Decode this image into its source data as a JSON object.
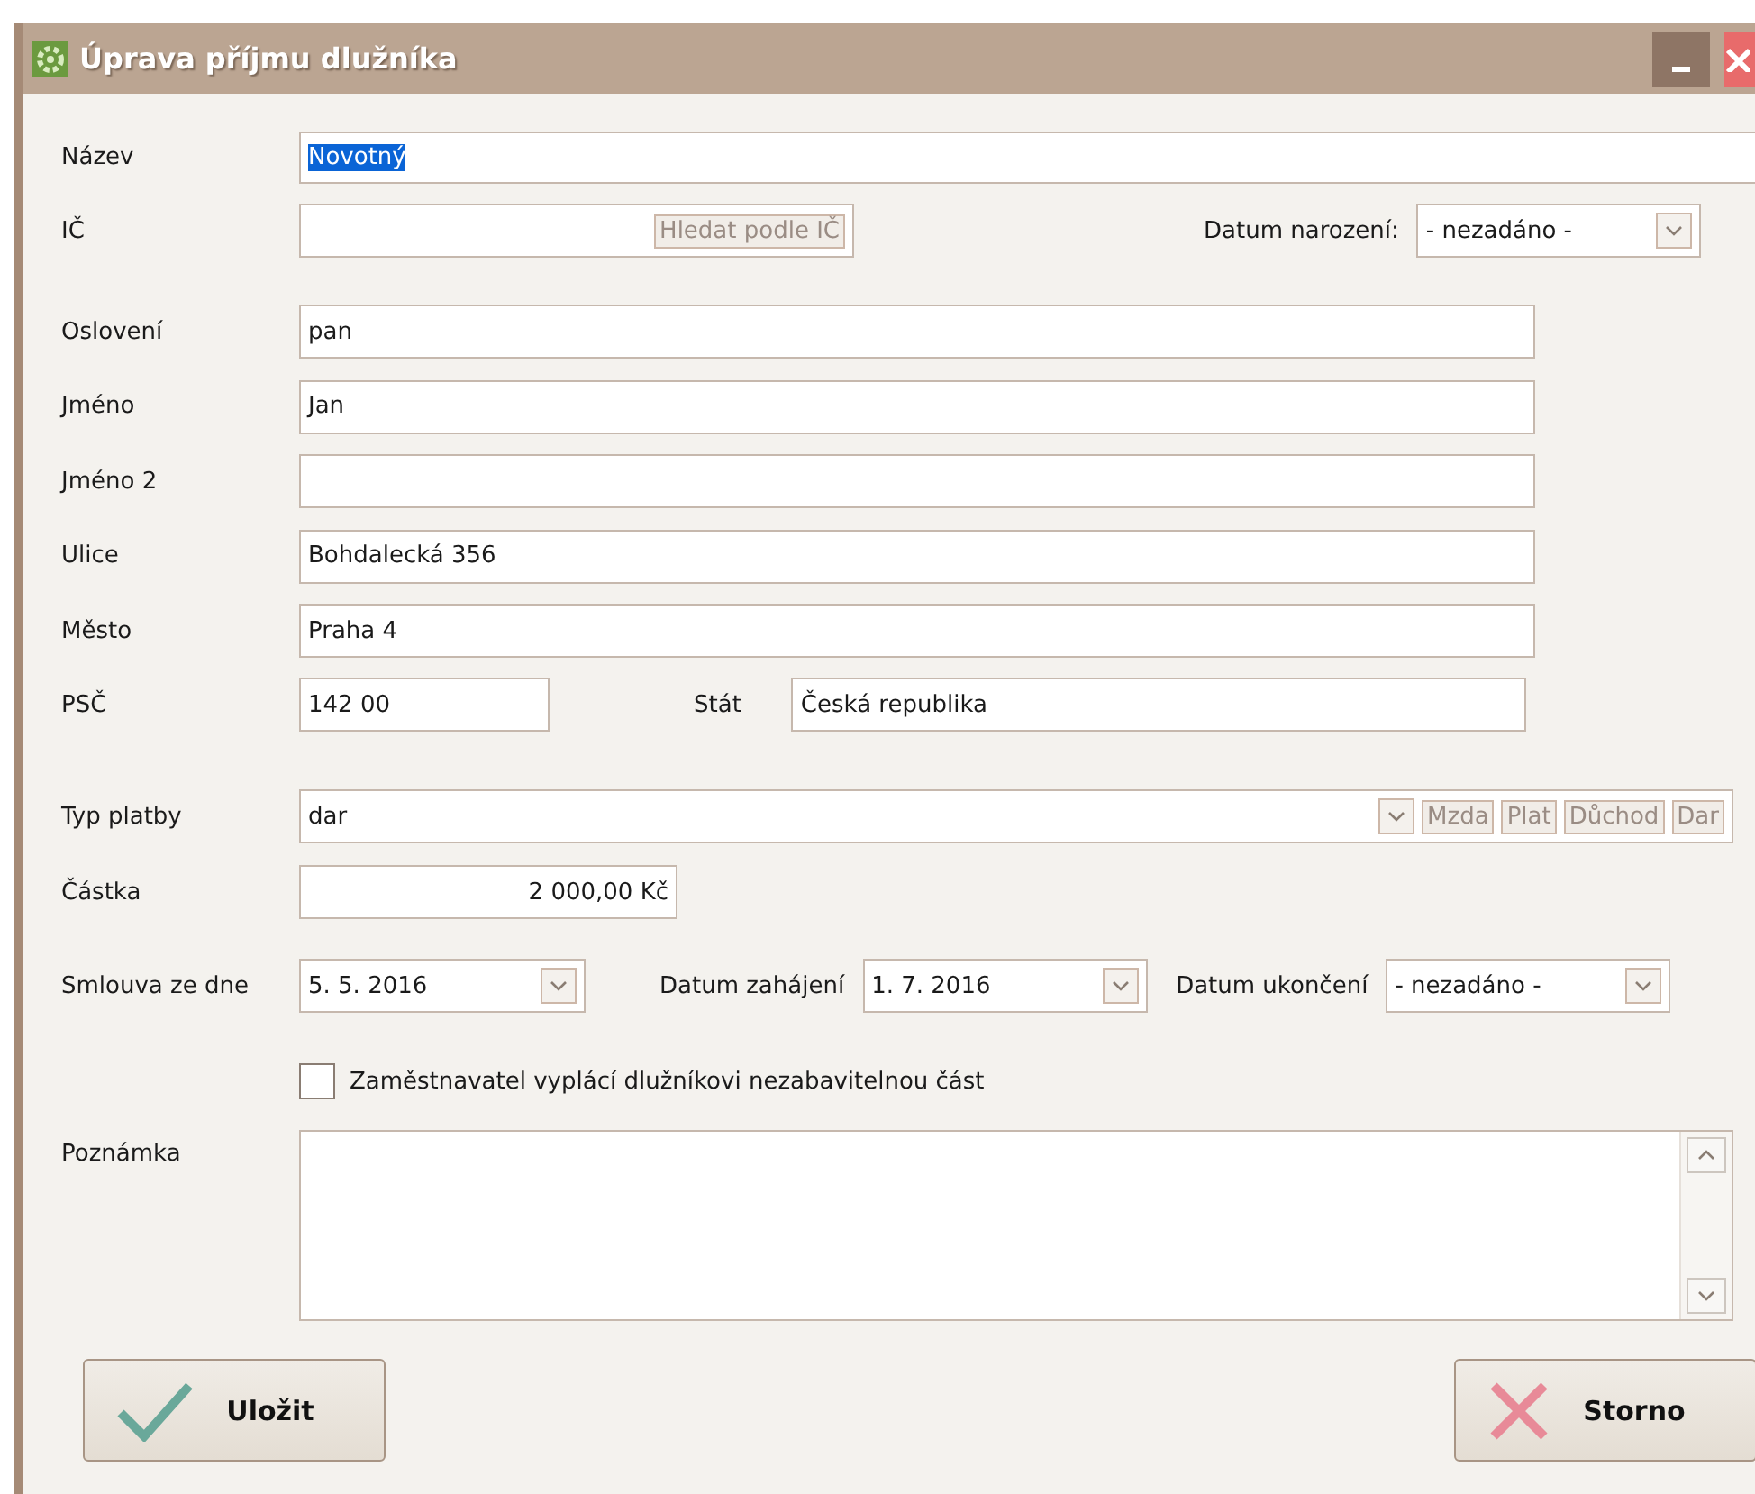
{
  "window": {
    "title": "Úprava příjmu dlužníka"
  },
  "name": {
    "label": "Název",
    "value": "Novotný",
    "selected": true
  },
  "ic": {
    "label": "IČ",
    "button": "Hledat podle IČ"
  },
  "birth_date": {
    "label": "Datum narození:",
    "value": "- nezadáno -"
  },
  "address": [
    {
      "label": "Oslovení",
      "value": "pan"
    },
    {
      "label": "Jméno",
      "value": "Jan"
    },
    {
      "label": "Jméno 2"
    },
    {
      "label": "Ulice",
      "value": "Bohdalecká 356"
    },
    {
      "label": "Město",
      "value": "Praha 4"
    }
  ],
  "postal": {
    "label": "PSČ",
    "value": "142 00"
  },
  "country": {
    "label": "Stát",
    "value": "Česká republika"
  },
  "payment_type": {
    "label": "Typ platby",
    "value": "dar",
    "quick_buttons": [
      "Mzda",
      "Plat",
      "Důchod",
      "Dar"
    ]
  },
  "amount": {
    "label": "Částka",
    "value": "2 000,00 Kč"
  },
  "dates": [
    {
      "label": "Smlouva ze dne",
      "value": "5. 5. 2016"
    },
    {
      "label": "Datum zahájení",
      "value": "1. 7. 2016"
    },
    {
      "label": "Datum ukončení",
      "value": "- nezadáno -"
    }
  ],
  "employer_pays": {
    "label": "Zaměstnavatel vyplácí dlužníkovi nezabavitelnou část",
    "checked": false
  },
  "note": {
    "label": "Poznámka"
  },
  "buttons": [
    {
      "label": "Uložit",
      "kind": "save"
    },
    {
      "label": "Storno",
      "kind": "cancel"
    }
  ]
}
